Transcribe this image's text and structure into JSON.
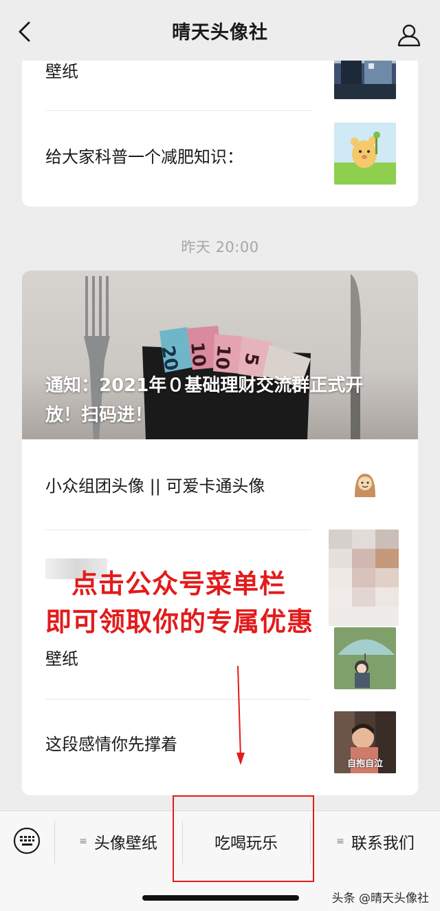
{
  "header": {
    "title": "晴天头像社",
    "back_icon": "chevron-left-icon",
    "user_icon": "user-icon"
  },
  "card1": {
    "items": [
      {
        "title": "壁纸"
      },
      {
        "title": "给大家科普一个减肥知识："
      }
    ]
  },
  "timestamp": "昨天 20:00",
  "card2": {
    "cover_title": "通知：2021年０基础理财交流群正式开放！扫码进！",
    "items": [
      {
        "title": "小众组团头像 || 可爱卡通头像"
      },
      {
        "title": "壁纸"
      },
      {
        "title": "这段感情你先撑着"
      }
    ],
    "thumb_caption": "自抱自泣"
  },
  "promo": {
    "line1": "点击公众号菜单栏",
    "line2": "即可领取你的专属优惠"
  },
  "menu": {
    "keyboard_icon": "keyboard-icon",
    "items": [
      {
        "label": "头像壁纸"
      },
      {
        "label": "吃喝玩乐"
      },
      {
        "label": "联系我们"
      }
    ]
  },
  "watermark": "头条 @晴天头像社",
  "colors": {
    "background": "#ededed",
    "accent_red": "#e21b1b"
  }
}
